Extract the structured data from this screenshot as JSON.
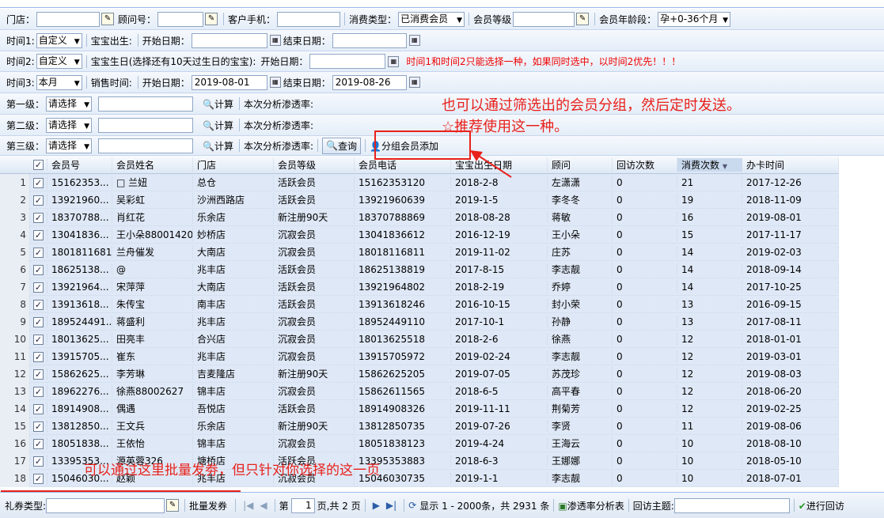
{
  "filters": {
    "row1": {
      "store_label": "门店：",
      "consultant_label": "顾问号：",
      "phone_label": "客户手机：",
      "consume_type_label": "消费类型：",
      "consume_type_value": "已消费会员",
      "level_label": "会员等级",
      "age_label": "会员年龄段：",
      "age_value": "孕+0-36个月"
    },
    "row2": {
      "label": "时间1:",
      "mode": "自定义",
      "field_label": "宝宝出生:",
      "start_label": "开始日期：",
      "end_label": "结束日期："
    },
    "row3": {
      "label": "时间2:",
      "mode": "自定义",
      "field_label": "宝宝生日(选择还有10天过生日的宝宝):",
      "start_label": "开始日期：",
      "end_label": "结束日期：",
      "warning": "时间1和时间2只能选择一种，如果同时选中，以时间2优先！！！"
    },
    "row4": {
      "label": "时间3:",
      "mode": "本月",
      "field_label": "销售时间:",
      "start_label": "开始日期：",
      "start_value": "2019-08-01",
      "end_label": "结束日期：",
      "end_value": "2019-08-26"
    },
    "levels": [
      {
        "label": "第一级：",
        "select": "请选择",
        "calc": "计算",
        "rate": "本次分析渗透率:"
      },
      {
        "label": "第二级：",
        "select": "请选择",
        "calc": "计算",
        "rate": "本次分析渗透率:"
      },
      {
        "label": "第三级：",
        "select": "请选择",
        "calc": "计算",
        "rate": "本次分析渗透率:"
      }
    ],
    "query_label": "查询",
    "group_add_label": "分组会员添加"
  },
  "annotations": {
    "top_line1": "也可以通过筛选出的会员分组，然后定时发送。",
    "top_line2": "☆推荐使用这一种。",
    "bottom": "可以通过这里批量发劵，但只针对你选择的这一页"
  },
  "grid": {
    "columns": [
      "会员号",
      "会员姓名",
      "门店",
      "会员等级",
      "会员电话",
      "宝宝出生日期",
      "顾问",
      "回访次数",
      "消费次数",
      "办卡时间"
    ],
    "rows": [
      [
        "15162353...",
        "□ 兰妞",
        "总仓",
        "活跃会员",
        "15162353120",
        "2018-2-8",
        "左潇潇",
        "0",
        "21",
        "2017-12-26"
      ],
      [
        "13921960...",
        "吴彩虹",
        "沙洲西路店",
        "活跃会员",
        "13921960639",
        "2019-1-5",
        "李冬冬",
        "0",
        "19",
        "2018-11-09"
      ],
      [
        "18370788...",
        "肖红花",
        "乐余店",
        "新注册90天",
        "18370788869",
        "2018-08-28",
        "蒋敏",
        "0",
        "16",
        "2019-08-01"
      ],
      [
        "13041836...",
        "王小朵88001420",
        "妙桥店",
        "沉寂会员",
        "13041836612",
        "2016-12-19",
        "王小朵",
        "0",
        "15",
        "2017-11-17"
      ],
      [
        "18018116811",
        "兰舟催发",
        "大南店",
        "沉寂会员",
        "18018116811",
        "2019-11-02",
        "庄苏",
        "0",
        "14",
        "2019-02-03"
      ],
      [
        "18625138...",
        "@",
        "兆丰店",
        "活跃会员",
        "18625138819",
        "2017-8-15",
        "李志靓",
        "0",
        "14",
        "2018-09-14"
      ],
      [
        "13921964...",
        "宋萍萍",
        "大南店",
        "活跃会员",
        "13921964802",
        "2018-2-19",
        "乔婷",
        "0",
        "14",
        "2017-10-25"
      ],
      [
        "13913618...",
        "朱传宝",
        "南丰店",
        "活跃会员",
        "13913618246",
        "2016-10-15",
        "封小荣",
        "0",
        "13",
        "2016-09-15"
      ],
      [
        "189524491...",
        "蒋盛利",
        "兆丰店",
        "沉寂会员",
        "18952449110",
        "2017-10-1",
        "孙静",
        "0",
        "13",
        "2017-08-11"
      ],
      [
        "18013625...",
        "田亮丰",
        "合兴店",
        "沉寂会员",
        "18013625518",
        "2018-2-6",
        "徐燕",
        "0",
        "12",
        "2018-01-01"
      ],
      [
        "13915705...",
        "崔东",
        "兆丰店",
        "沉寂会员",
        "13915705972",
        "2019-02-24",
        "李志靓",
        "0",
        "12",
        "2019-03-01"
      ],
      [
        "15862625...",
        "李芳琳",
        "吉麦隆店",
        "新注册90天",
        "15862625205",
        "2019-07-05",
        "苏茂珍",
        "0",
        "12",
        "2019-08-03"
      ],
      [
        "18962276...",
        "徐燕88002627",
        "锦丰店",
        "沉寂会员",
        "15862611565",
        "2018-6-5",
        "高平春",
        "0",
        "12",
        "2018-06-20"
      ],
      [
        "18914908...",
        "偶遇",
        "吾悦店",
        "活跃会员",
        "18914908326",
        "2019-11-11",
        "荆菊芳",
        "0",
        "12",
        "2019-02-25"
      ],
      [
        "13812850...",
        "王文兵",
        "乐余店",
        "新注册90天",
        "13812850735",
        "2019-07-26",
        "李贤",
        "0",
        "11",
        "2019-08-06"
      ],
      [
        "18051838...",
        "王依怡",
        "锦丰店",
        "沉寂会员",
        "18051838123",
        "2019-4-24",
        "王海云",
        "0",
        "10",
        "2018-08-10"
      ],
      [
        "13395353...",
        "源英蓉326",
        "塘桥店",
        "活跃会员",
        "13395353883",
        "2018-6-3",
        "王娜娜",
        "0",
        "10",
        "2018-05-10"
      ],
      [
        "15046030...",
        "赵颖",
        "兆丰店",
        "沉寂会员",
        "15046030735",
        "2019-1-1",
        "李志靓",
        "0",
        "10",
        "2018-07-01"
      ]
    ]
  },
  "bottom": {
    "coupon_label": "礼券类型:",
    "batch_label": "批量发券",
    "page_label": "第",
    "page_value": "1",
    "page_total": "页,共 2 页",
    "display_text": "显示 1 - 2000条，共 2931 条",
    "analysis_label": "渗透率分析表",
    "topic_label": "回访主题:",
    "visit_label": "进行回访"
  }
}
